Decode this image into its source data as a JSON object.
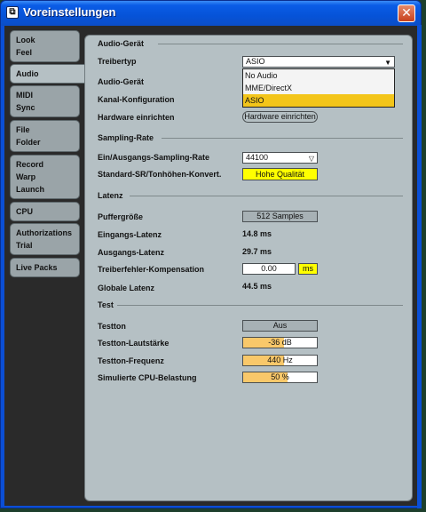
{
  "window": {
    "title": "Voreinstellungen",
    "app_icon": "ableton-logo-icon",
    "close_label": "✕"
  },
  "sidebar": {
    "items": [
      {
        "label_lines": [
          "Look",
          "Feel"
        ]
      },
      {
        "label_lines": [
          "Audio"
        ],
        "active": true
      },
      {
        "label_lines": [
          "MIDI",
          "Sync"
        ]
      },
      {
        "label_lines": [
          "File",
          "Folder"
        ]
      },
      {
        "label_lines": [
          "Record",
          "Warp",
          "Launch"
        ]
      },
      {
        "label_lines": [
          "CPU"
        ]
      },
      {
        "label_lines": [
          "Authorizations",
          "Trial"
        ]
      },
      {
        "label_lines": [
          "Live Packs"
        ]
      }
    ]
  },
  "audio_device": {
    "section": "Audio-Gerät",
    "driver_type_label": "Treibertyp",
    "driver_type_value": "ASIO",
    "driver_options": [
      "No Audio",
      "MME/DirectX",
      "ASIO"
    ],
    "device_label": "Audio-Gerät",
    "channel_config_label": "Kanal-Konfiguration",
    "hardware_setup_label": "Hardware einrichten",
    "hardware_setup_button": "Hardware einrichten"
  },
  "sampling": {
    "section": "Sampling-Rate",
    "io_rate_label": "Ein/Ausgangs-Sampling-Rate",
    "io_rate_value": "44100",
    "default_sr_label": "Standard-SR/Tonhöhen-Konvert.",
    "default_sr_value": "Hohe Qualität"
  },
  "latency": {
    "section": "Latenz",
    "buffer_label": "Puffergröße",
    "buffer_value": "512 Samples",
    "input_latency_label": "Eingangs-Latenz",
    "input_latency_value": "14.8 ms",
    "output_latency_label": "Ausgangs-Latenz",
    "output_latency_value": "29.7 ms",
    "driver_comp_label": "Treiberfehler-Kompensation",
    "driver_comp_value": "0.00",
    "driver_comp_unit": "ms",
    "overall_label": "Globale Latenz",
    "overall_value": "44.5 ms"
  },
  "test": {
    "section": "Test",
    "tone_label": "Testton",
    "tone_value": "Aus",
    "volume_label": "Testton-Lautstärke",
    "volume_value": "-36 dB",
    "volume_fill": 0.55,
    "freq_label": "Testton-Frequenz",
    "freq_value": "440 Hz",
    "freq_fill": 0.55,
    "cpu_label": "Simulierte CPU-Belastung",
    "cpu_value": "50 %",
    "cpu_fill": 0.6
  },
  "colors": {
    "accent_yellow": "#ffff00",
    "slider_fill": "#f9c86a",
    "dropdown_selected": "#f3c51a",
    "titlebar": "#0653d8"
  }
}
